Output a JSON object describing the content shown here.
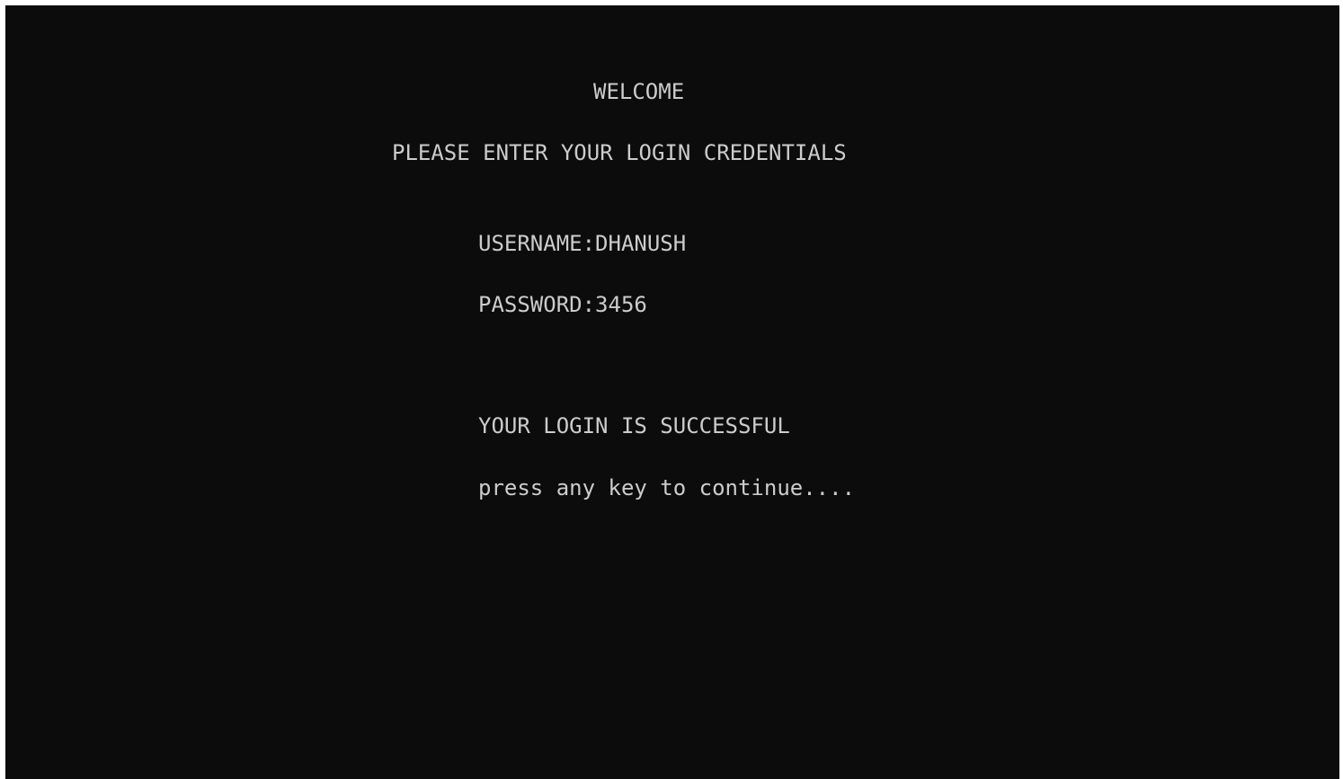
{
  "console": {
    "lines": {
      "welcome": "WELCOME",
      "prompt": "PLEASE ENTER YOUR LOGIN CREDENTIALS",
      "username": "USERNAME:DHANUSH",
      "password": "PASSWORD:3456",
      "success": "YOUR LOGIN IS SUCCESSFUL",
      "continue": "press any key to continue...."
    },
    "colors": {
      "background": "#0c0c0c",
      "text": "#cccccc"
    }
  }
}
